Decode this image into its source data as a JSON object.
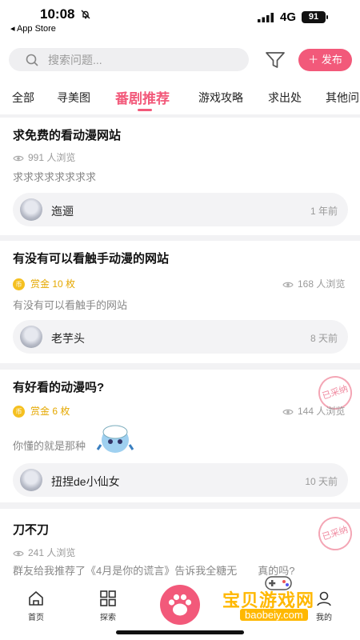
{
  "status_bar": {
    "time": "10:08",
    "back_app": "◂ App Store",
    "network": "4G",
    "battery": "91"
  },
  "search": {
    "placeholder": "搜索问题...",
    "publish_label": "发布",
    "publish_icon": "plus-icon"
  },
  "tabs": [
    {
      "label": "全部",
      "active": false
    },
    {
      "label": "寻美图",
      "active": false
    },
    {
      "label": "番剧推荐",
      "active": true
    },
    {
      "label": "游戏攻略",
      "active": false
    },
    {
      "label": "求出处",
      "active": false
    },
    {
      "label": "其他问",
      "active": false
    }
  ],
  "posts": [
    {
      "title": "求免费的看动漫网站",
      "views": "991 人浏览",
      "body": "求求求求求求求求",
      "author": "迤逦",
      "time": "1 年前"
    },
    {
      "title": "有没有可以看触手动漫的网站",
      "bounty": "赏金 10 枚",
      "views": "168 人浏览",
      "body": "有没有可以看触手的网站",
      "author": "老芋头",
      "time": "8 天前"
    },
    {
      "title": "有好看的动漫吗?",
      "bounty": "赏金 6 枚",
      "views": "144 人浏览",
      "body": "你懂的就是那种",
      "author": "扭捏de小仙女",
      "time": "10 天前",
      "stamp": "已采纳"
    },
    {
      "title": "刀不刀",
      "views": "241 人浏览",
      "body": "群友给我推荐了《4月是你的谎言》告诉我全糖无",
      "body_tail": "真的吗?",
      "stamp": "已采纳"
    }
  ],
  "coin_glyph": "币",
  "bottom_nav": [
    {
      "label": "首页",
      "icon": "home-icon"
    },
    {
      "label": "探索",
      "icon": "grid-icon"
    },
    {
      "label": "我的",
      "icon": "profile-icon"
    }
  ],
  "watermark": {
    "text": "宝贝游戏网",
    "url": "baobeiy.com"
  },
  "colors": {
    "accent": "#f2597a",
    "bounty": "#e5a800",
    "muted": "#999999"
  }
}
